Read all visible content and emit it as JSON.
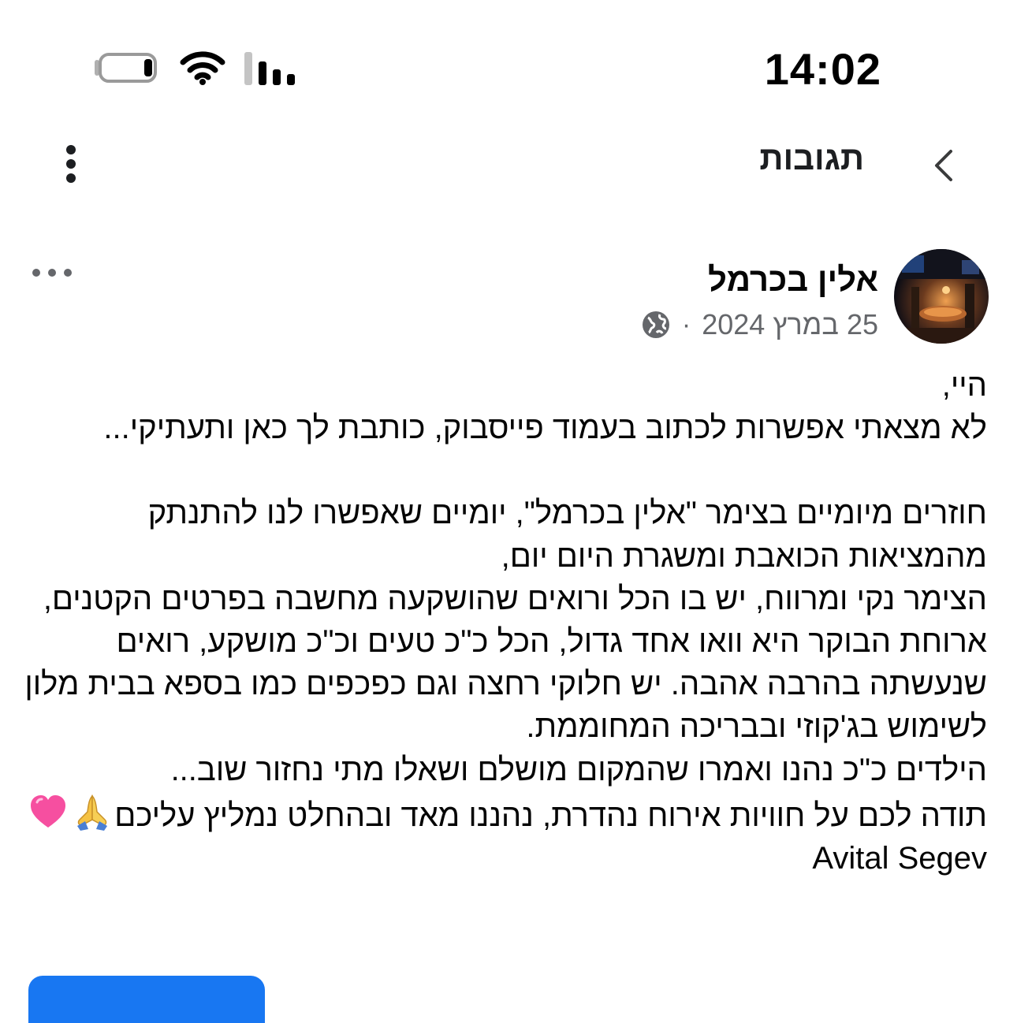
{
  "status_bar": {
    "time": "14:02",
    "battery_icon": "battery-icon",
    "wifi_icon": "wifi-icon",
    "signal_icon": "cellular-signal-icon"
  },
  "header": {
    "title": "תגובות",
    "back_icon": "chevron-right-icon",
    "menu_icon": "vertical-dots-icon"
  },
  "post": {
    "author": "אלין בכרמל",
    "date": "25 במרץ 2024",
    "separator": "·",
    "privacy_icon": "globe-icon",
    "more_icon": "horizontal-dots-icon",
    "lines": [
      "היי,",
      "לא מצאתי אפשרות לכתוב בעמוד פייסבוק, כותבת לך כאן ותעתיקי...",
      "",
      "חוזרים מיומיים בצימר \"אלין בכרמל\", יומיים שאפשרו לנו להתנתק מהמציאות הכואבת ומשגרת היום יום,",
      "הצימר נקי ומרווח, יש בו הכל ורואים שהושקעה מחשבה בפרטים הקטנים, ארוחת הבוקר היא וואו אחד גדול, הכל כ\"כ טעים וכ\"כ מושקע, רואים שנעשתה בהרבה אהבה. יש חלוקי רחצה וגם כפכפים כמו בספא בבית מלון לשימוש בג'קוזי ובבריכה המחוממת.",
      "הילדים כ\"כ נהנו ואמרו שהמקום מושלם ושאלו מתי נחזור שוב...",
      "תודה לכם על חוויות אירוח נהדרת, נהננו מאד ובהחלט נמליץ עליכם"
    ],
    "emojis": [
      "folded-hands-emoji",
      "pink-heart-emoji"
    ],
    "signature": "Avital Segev"
  },
  "colors": {
    "text": "#050505",
    "secondary_text": "#65676b",
    "accent": "#1877f2",
    "header_text": "#1c1e21"
  }
}
